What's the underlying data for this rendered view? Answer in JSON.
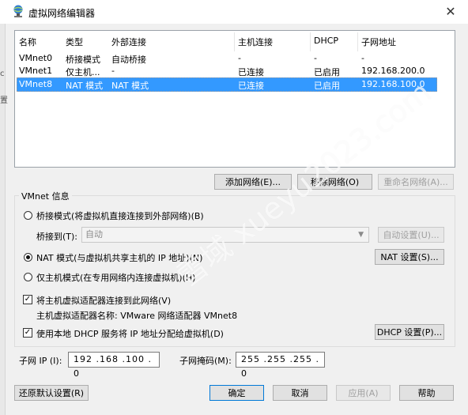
{
  "window": {
    "title": "虚拟网络编辑器",
    "close_glyph": "✕"
  },
  "left_fragments": [
    "c",
    "置"
  ],
  "table": {
    "headers": [
      "名称",
      "类型",
      "外部连接",
      "主机连接",
      "DHCP",
      "子网地址"
    ],
    "rows": [
      [
        "VMnet0",
        "桥接模式",
        "自动桥接",
        "-",
        "-",
        "-"
      ],
      [
        "VMnet1",
        "仅主机...",
        "-",
        "已连接",
        "已启用",
        "192.168.200.0"
      ],
      [
        "VMnet8",
        "NAT 模式",
        "NAT 模式",
        "已连接",
        "已启用",
        "192.168.100.0"
      ]
    ],
    "selected_index": 2
  },
  "net_buttons": {
    "add": "添加网络(E)...",
    "remove": "移除网络(O)",
    "rename": "重命名网络(A)..."
  },
  "vmnet_info": {
    "title": "VMnet 信息",
    "bridge_label": "桥接模式(将虚拟机直接连接到外部网络)(B)",
    "bridge_to_label": "桥接到(T):",
    "bridge_to_value": "自动",
    "auto_settings": "自动设置(U)...",
    "nat_label": "NAT 模式(与虚拟机共享主机的 IP 地址)(N)",
    "nat_settings": "NAT 设置(S)...",
    "host_only_label": "仅主机模式(在专用网络内连接虚拟机)(H)",
    "connect_adapter_label": "将主机虚拟适配器连接到此网络(V)",
    "adapter_name_label": "主机虚拟适配器名称: VMware 网络适配器 VMnet8",
    "dhcp_label": "使用本地 DHCP 服务将 IP 地址分配给虚拟机(D)",
    "dhcp_settings": "DHCP 设置(P)...",
    "subnet_ip_label": "子网 IP (I):",
    "subnet_ip": "192 .168 .100 . 0",
    "subnet_mask_label": "子网掩码(M):",
    "subnet_mask": "255 .255 .255 . 0",
    "selected_mode": "nat",
    "connect_adapter_checked": true,
    "dhcp_checked": true
  },
  "footer": {
    "restore": "还原默认设置(R)",
    "ok": "确定",
    "cancel": "取消",
    "apply": "应用(A)",
    "help": "帮助"
  },
  "watermark": "雪域 xueyu2023.com"
}
